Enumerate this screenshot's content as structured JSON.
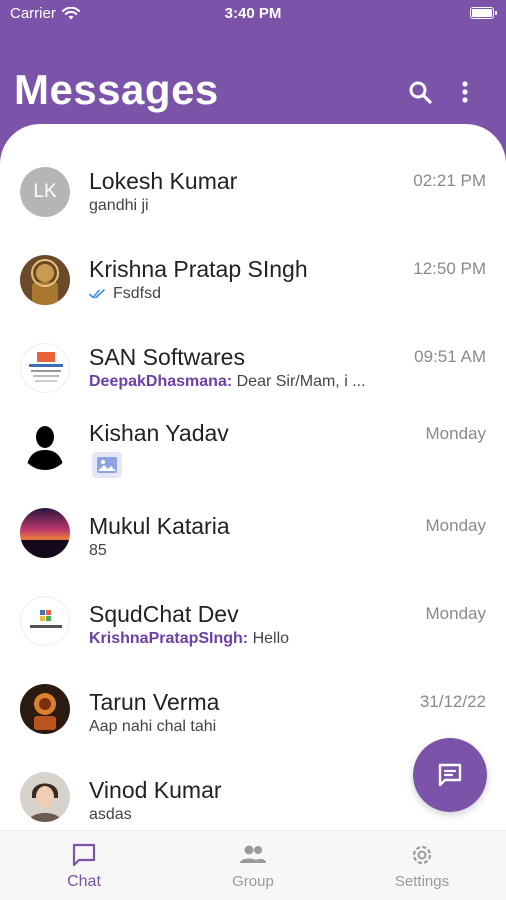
{
  "status_bar": {
    "carrier": "Carrier",
    "time": "3:40 PM"
  },
  "header": {
    "title": "Messages"
  },
  "chats": [
    {
      "name": "Lokesh Kumar",
      "time": "02:21 PM",
      "preview": "gandhi ji",
      "initials": "LK",
      "avatar": "initials"
    },
    {
      "name": "Krishna Pratap SIngh",
      "time": "12:50 PM",
      "preview": "Fsdfsd",
      "status": "double-check-icon",
      "avatar": "photo"
    },
    {
      "name": "SAN Softwares",
      "time": "09:51 AM",
      "sender": "DeepakDhasmana:",
      "preview": "Dear Sir/Mam, i ...",
      "avatar": "logo"
    },
    {
      "name": "Kishan Yadav",
      "time": "Monday",
      "preview_icon": "image-icon",
      "avatar": "silhouette"
    },
    {
      "name": "Mukul Kataria",
      "time": "Monday",
      "preview": "85",
      "avatar": "photo"
    },
    {
      "name": "SqudChat Dev",
      "time": "Monday",
      "sender": "KrishnaPratapSIngh:",
      "preview": "Hello",
      "avatar": "logo"
    },
    {
      "name": "Tarun Verma",
      "time": "31/12/22",
      "preview": "Aap nahi chal tahi",
      "avatar": "photo"
    },
    {
      "name": "Vinod Kumar",
      "time": "",
      "preview": "asdas",
      "avatar": "photo"
    }
  ],
  "fab": {
    "icon": "message-icon"
  },
  "tabs": [
    {
      "label": "Chat",
      "icon": "chat-icon",
      "active": true
    },
    {
      "label": "Group",
      "icon": "group-icon",
      "active": false
    },
    {
      "label": "Settings",
      "icon": "gear-icon",
      "active": false
    }
  ],
  "colors": {
    "primary": "#7b53a8",
    "sender": "#6e3fa6",
    "check": "#3a8ee6",
    "muted": "#8a8a8a"
  }
}
